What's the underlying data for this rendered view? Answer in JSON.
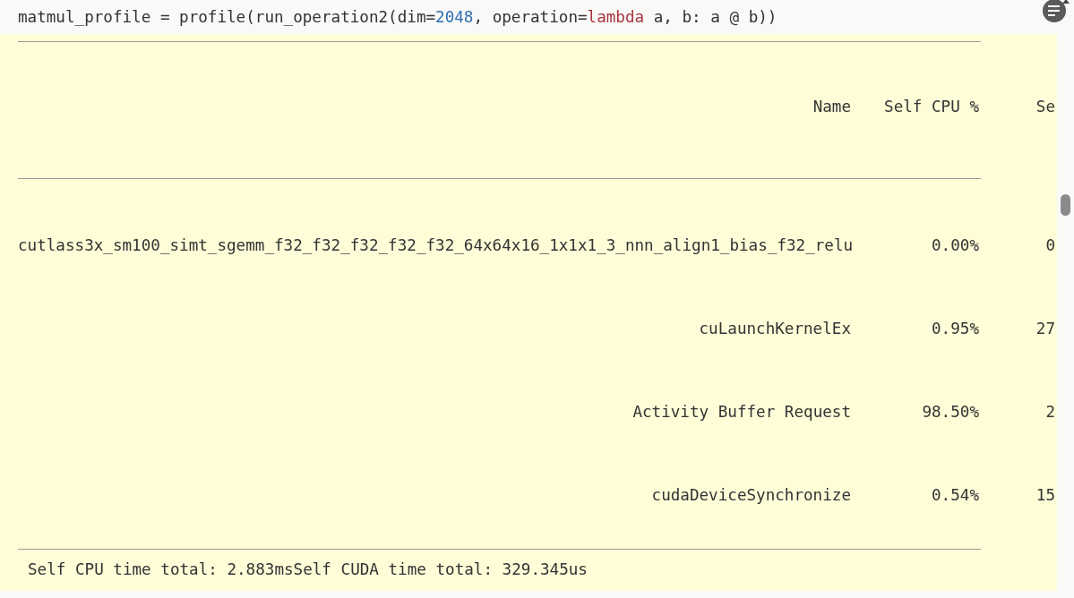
{
  "code_line": [
    {
      "kind": "plain",
      "text": "matmul_profile = profile(run_operation2(dim="
    },
    {
      "kind": "number",
      "text": "2048"
    },
    {
      "kind": "plain",
      "text": ", operation="
    },
    {
      "kind": "keyword",
      "text": "lambda"
    },
    {
      "kind": "plain",
      "text": " a, b: a @ b))"
    }
  ],
  "table": {
    "columns": [
      "Name",
      "Self CPU %",
      "Se"
    ],
    "rows": [
      [
        "cutlass3x_sm100_simt_sgemm_f32_f32_f32_f32_f32_64x64x16_1x1x1_3_nnn_align1_bias_f32_relu",
        "0.00%",
        "0"
      ],
      [
        "cuLaunchKernelEx",
        "0.95%",
        "27"
      ],
      [
        "Activity Buffer Request",
        "98.50%",
        "2"
      ],
      [
        "cudaDeviceSynchronize",
        "0.54%",
        "15"
      ]
    ]
  },
  "footer": "Self CPU time total: 2.883msSelf CUDA time total: 329.345us"
}
